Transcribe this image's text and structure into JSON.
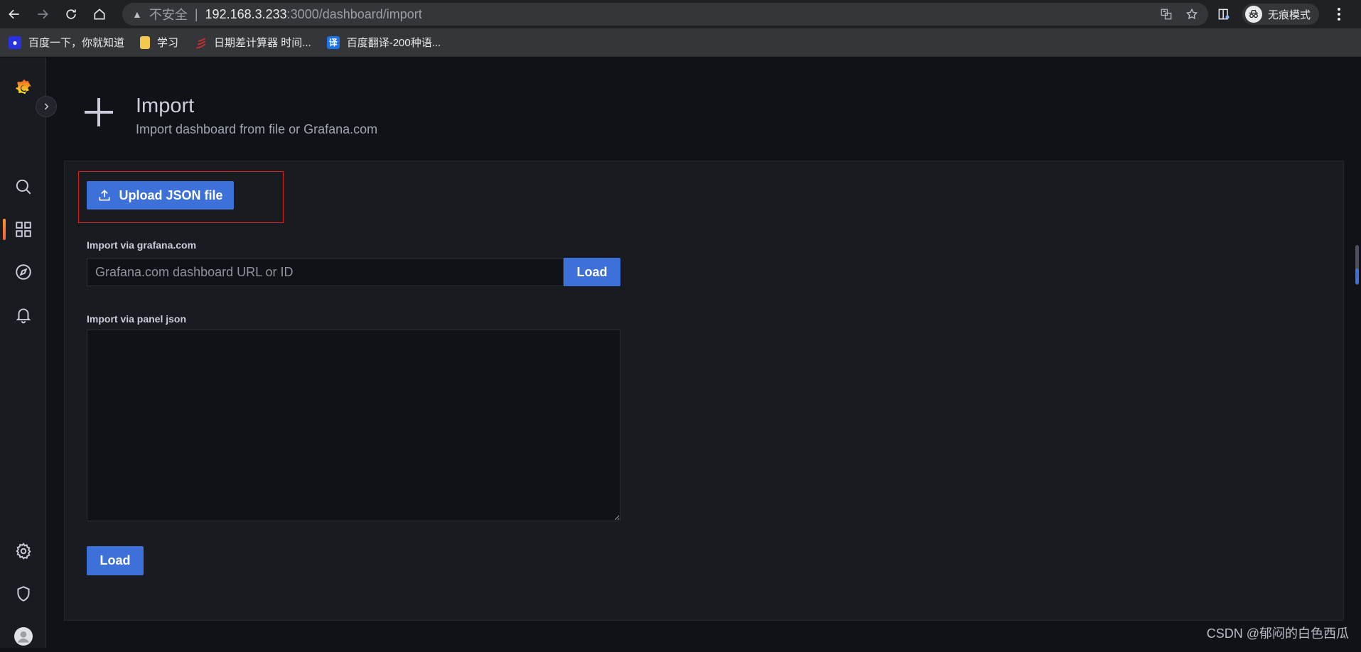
{
  "browser": {
    "address": {
      "insecure_label": "不安全",
      "separator": "|",
      "host": "192.168.3.233",
      "path": ":3000/dashboard/import"
    },
    "profile_label": "无痕模式",
    "bookmarks": [
      {
        "label": "百度一下，你就知道",
        "icon": "baidu-paw-icon",
        "color": "#2932e1"
      },
      {
        "label": "学习",
        "icon": "folder-icon",
        "color": "#f2c94c"
      },
      {
        "label": "日期差计算器 时间...",
        "icon": "calc-site-icon",
        "color": "#d32f2f"
      },
      {
        "label": "百度翻译-200种语...",
        "icon": "translate-icon",
        "color": "#1a73e8",
        "glyph": "译"
      }
    ]
  },
  "sidemenu": {
    "items": [
      "grafana-logo",
      "search-icon",
      "dashboards-icon",
      "explore-icon",
      "alerting-icon",
      "config-icon",
      "shield-icon",
      "user-avatar",
      "help-icon"
    ],
    "accent": "#ff9830"
  },
  "header": {
    "title": "Import",
    "subtitle": "Import dashboard from file or Grafana.com"
  },
  "import": {
    "upload_label": "Upload JSON file",
    "gcom_label": "Import via grafana.com",
    "gcom_placeholder": "Grafana.com dashboard URL or ID",
    "gcom_load_label": "Load",
    "json_label": "Import via panel json",
    "json_value": "",
    "json_load_label": "Load"
  },
  "colors": {
    "primary": "#3d71d9",
    "highlight": "#e02020"
  },
  "watermark": "CSDN @郁闷的白色西瓜"
}
